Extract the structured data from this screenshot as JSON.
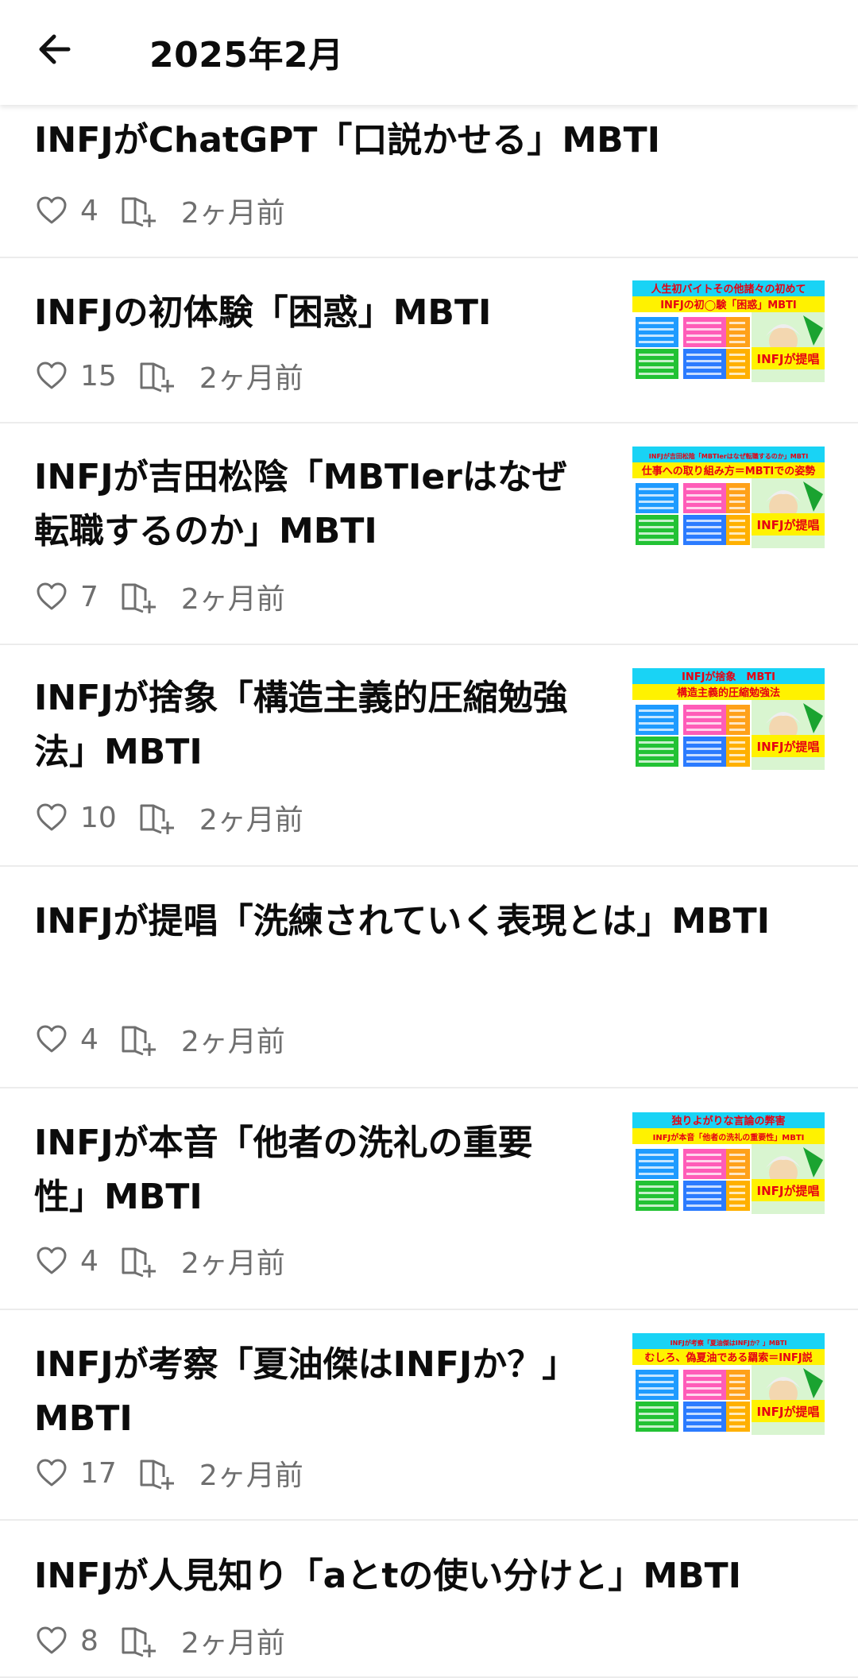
{
  "header": {
    "title": "2025年2月"
  },
  "articles": [
    {
      "title_lines": [
        "INFJがChatGPT「口説かせる」MBTI"
      ],
      "likes": "4",
      "age": "2ヶ月前"
    },
    {
      "title_lines": [
        "INFJの初体験「困惑」MBTI"
      ],
      "likes": "15",
      "age": "2ヶ月前",
      "thumb": {
        "line1": "人生初バイトその他諸々の初めて",
        "line2": "INFJの初◯験「困惑」MBTI",
        "badge": "INFJが提唱"
      }
    },
    {
      "title_lines": [
        "INFJが吉田松陰「MBTIerはなぜ",
        "転職するのか」MBTI"
      ],
      "likes": "7",
      "age": "2ヶ月前",
      "thumb": {
        "line1": "INFJが吉田松陰「MBTIerはなぜ転職するのか」MBTI",
        "line2": "仕事への取り組み方＝MBTIでの姿勢",
        "badge": "INFJが提唱"
      }
    },
    {
      "title_lines": [
        "INFJが捨象「構造主義的圧縮勉強",
        "法」MBTI"
      ],
      "likes": "10",
      "age": "2ヶ月前",
      "thumb": {
        "line1": "INFJが捨象　MBTI",
        "line2": "構造主義的圧縮勉強法",
        "badge": "INFJが提唱"
      }
    },
    {
      "title_lines": [
        "INFJが提唱「洗練されていく表現とは」MBTI"
      ],
      "likes": "4",
      "age": "2ヶ月前"
    },
    {
      "title_lines": [
        "INFJが本音「他者の洗礼の重要",
        "性」MBTI"
      ],
      "likes": "4",
      "age": "2ヶ月前",
      "thumb": {
        "line1": "独りよがりな言論の弊害",
        "line2": "INFJが本音「他者の洗礼の重要性」MBTI",
        "badge": "INFJが提唱"
      }
    },
    {
      "title_lines": [
        "INFJが考察「夏油傑はINFJか？」",
        "MBTI"
      ],
      "likes": "17",
      "age": "2ヶ月前",
      "thumb": {
        "line1": "INFJが考察「夏油傑はINFJか？」MBTI",
        "line2": "むしろ、偽夏油である羂索＝INFJ説",
        "badge": "INFJが提唱"
      }
    },
    {
      "title_lines": [
        "INFJが人見知り「aとtの使い分けと」MBTI"
      ],
      "likes": "8",
      "age": "2ヶ月前"
    }
  ],
  "icons": {
    "back": "arrow-left-icon",
    "like": "heart-outline-icon",
    "save": "magazine-add-icon"
  },
  "colors": {
    "text": "#0c0c0c",
    "meta": "#6f6f6f",
    "divider": "#ececec",
    "thumb_red": "#e60012",
    "thumb_yellow": "#fff200",
    "thumb_cyan": "#19d3f5"
  }
}
